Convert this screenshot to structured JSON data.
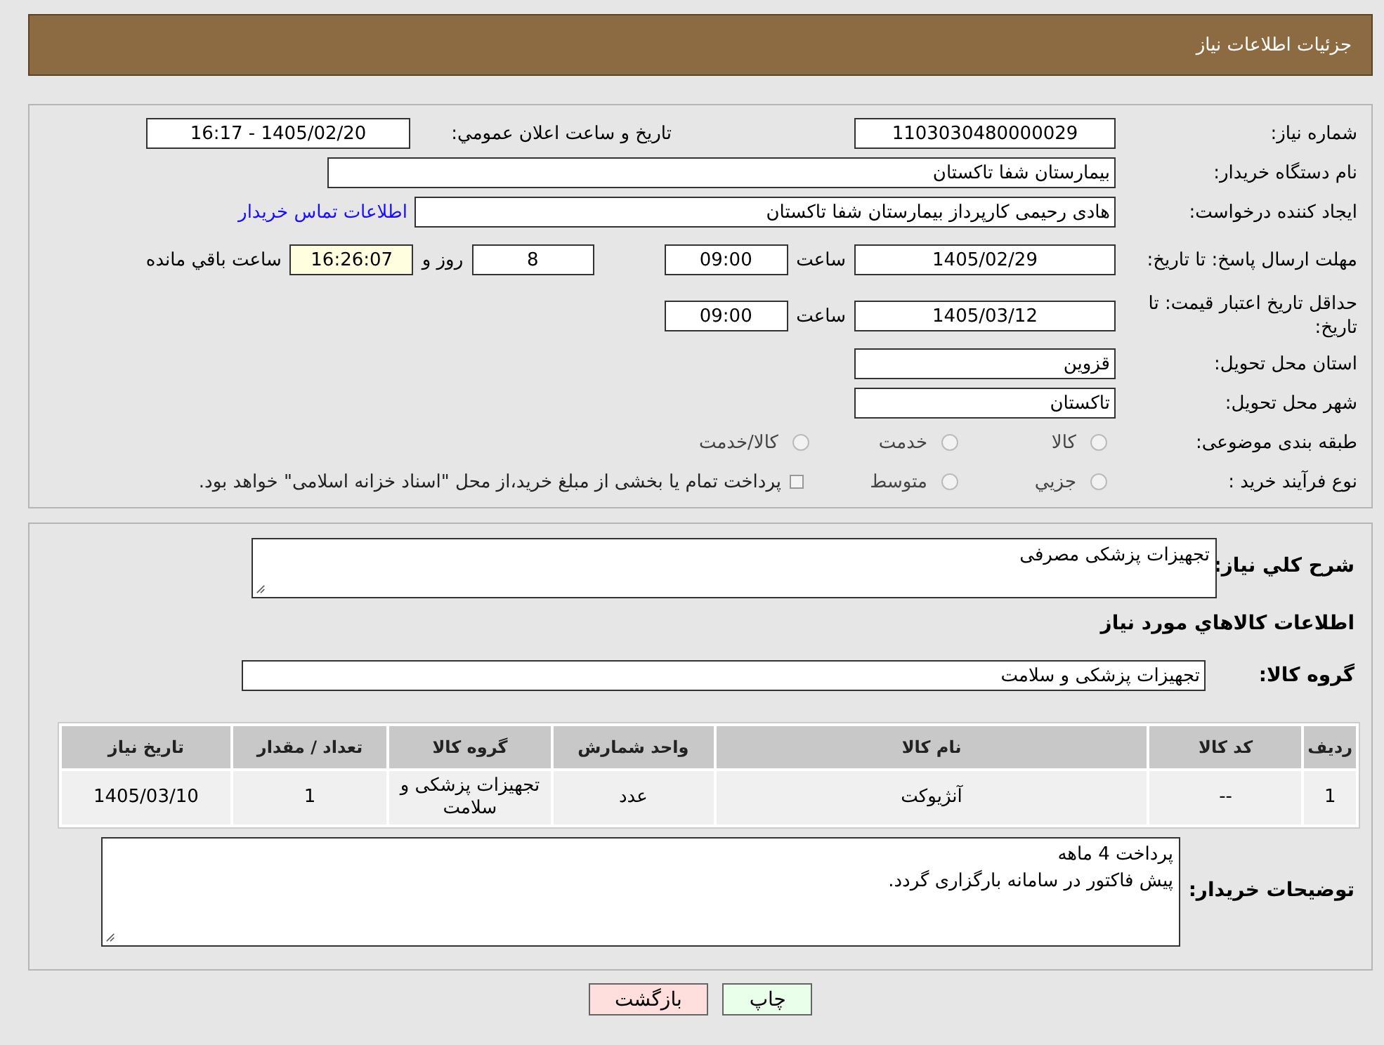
{
  "header": {
    "title": "جزئیات اطلاعات نیاز"
  },
  "details": {
    "need_number": {
      "label": "شماره نیاز:",
      "value": "1103030480000029"
    },
    "announce": {
      "label": "تاریخ و ساعت اعلان عمومي:",
      "value": "1405/02/20 - 16:17"
    },
    "buyer": {
      "label": "نام دستگاه خریدار:",
      "value": "بیمارستان شفا تاکستان"
    },
    "requester": {
      "label": "ایجاد کننده درخواست:",
      "value": "هادی رحیمی کارپرداز بیمارستان شفا تاکستان",
      "link": "اطلاعات تماس خریدار"
    },
    "deadline": {
      "label": "مهلت ارسال پاسخ: تا تاریخ:",
      "date": "1405/02/29",
      "time_label": "ساعت",
      "time": "09:00",
      "days": "8",
      "days_label": "روز و",
      "remaining": "16:26:07",
      "remaining_label": "ساعت باقي مانده"
    },
    "validity": {
      "label": "حداقل تاریخ اعتبار قیمت: تا تاریخ:",
      "date": "1405/03/12",
      "time_label": "ساعت",
      "time": "09:00"
    },
    "province": {
      "label": "استان محل تحویل:",
      "value": "قزوین"
    },
    "city": {
      "label": "شهر محل تحویل:",
      "value": "تاکستان"
    },
    "category": {
      "label": "طبقه بندی موضوعی:",
      "options": [
        {
          "label": "کالا",
          "selected": false
        },
        {
          "label": "خدمت",
          "selected": false
        },
        {
          "label": "کالا/خدمت",
          "selected": false
        }
      ]
    },
    "purchase_type": {
      "label": "نوع فرآیند خرید :",
      "options": [
        {
          "label": "جزيي",
          "selected": false
        },
        {
          "label": "متوسط",
          "selected": false
        }
      ],
      "note_checked": false,
      "note": "پرداخت تمام یا بخشی از مبلغ خرید،از محل \"اسناد خزانه اسلامی\" خواهد بود."
    }
  },
  "goods": {
    "description": {
      "label": "شرح کلي نیاز:",
      "value": "تجهیزات پزشکی مصرفی"
    },
    "heading": "اطلاعات کالاهاي مورد نیاز",
    "group": {
      "label": "گروه کالا:",
      "value": "تجهیزات پزشکی و سلامت"
    },
    "table": {
      "columns": [
        "ردیف",
        "کد کالا",
        "نام کالا",
        "واحد شمارش",
        "گروه کالا",
        "تعداد / مقدار",
        "تاریخ نیاز"
      ],
      "rows": [
        [
          "1",
          "--",
          "آنژیوکت",
          "عدد",
          "تجهیزات پزشکی و سلامت",
          "1",
          "1405/03/10"
        ]
      ]
    },
    "notes": {
      "label": "توضیحات خریدار:",
      "lines": [
        "پرداخت 4 ماهه",
        "پیش فاکتور در سامانه بارگزاری گردد."
      ]
    }
  },
  "buttons": [
    {
      "kind": "print",
      "label": "چاپ"
    },
    {
      "kind": "back",
      "label": "بازگشت"
    }
  ]
}
